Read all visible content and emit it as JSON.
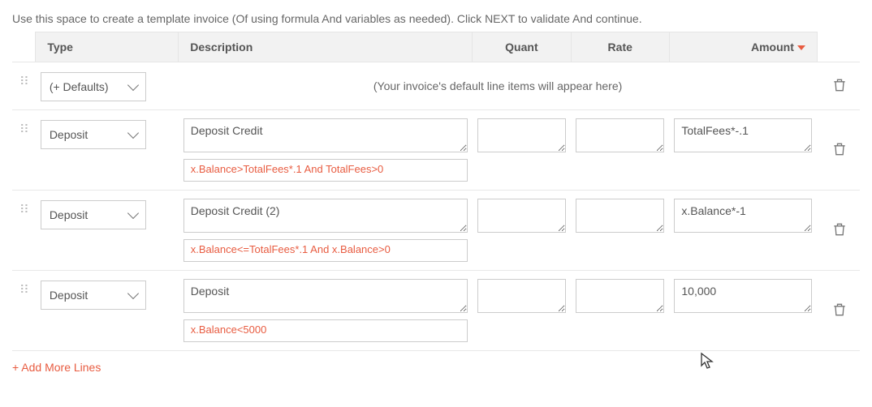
{
  "instructions": "Use this space to create a template invoice (Of using formula And variables as needed). Click NEXT to validate And continue.",
  "headers": {
    "type": "Type",
    "description": "Description",
    "quant": "Quant",
    "rate": "Rate",
    "amount": "Amount"
  },
  "defaults_row": {
    "type_label": "(+ Defaults)",
    "placeholder": "(Your invoice's default line items will appear here)"
  },
  "rows": [
    {
      "type": "Deposit",
      "description": "Deposit Credit",
      "quant": "",
      "rate": "",
      "amount": "TotalFees*-.1",
      "condition": "x.Balance>TotalFees*.1 And TotalFees>0"
    },
    {
      "type": "Deposit",
      "description": "Deposit Credit (2)",
      "quant": "",
      "rate": "",
      "amount": "x.Balance*-1",
      "condition": "x.Balance<=TotalFees*.1 And x.Balance>0"
    },
    {
      "type": "Deposit",
      "description": "Deposit",
      "quant": "",
      "rate": "",
      "amount": "10,000",
      "condition": "x.Balance<5000"
    }
  ],
  "add_more_label": "+ Add More Lines"
}
